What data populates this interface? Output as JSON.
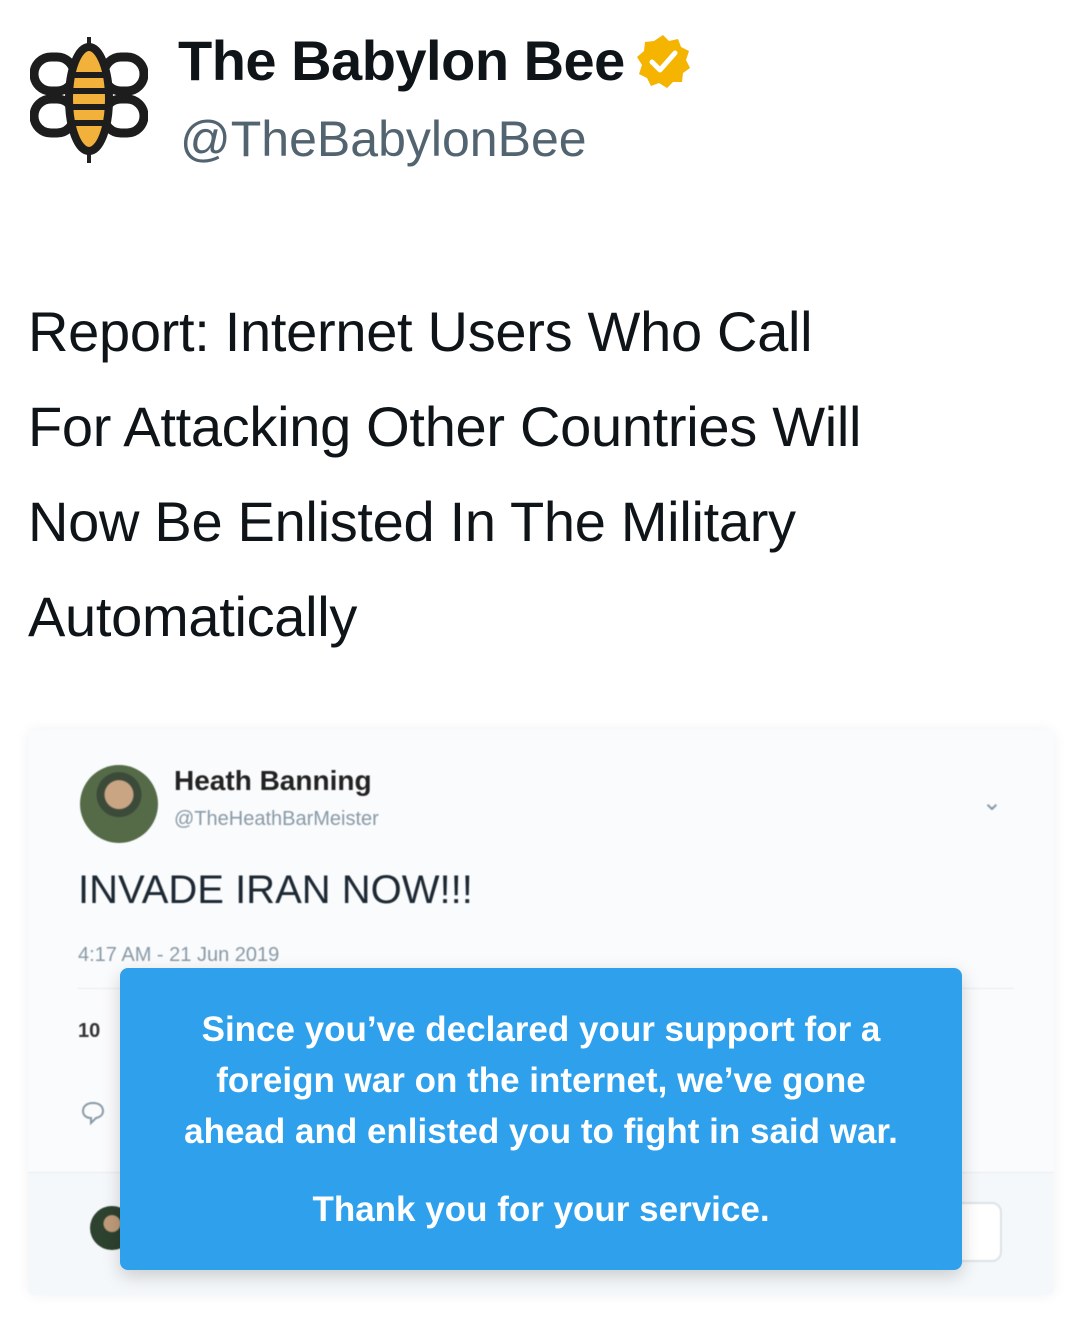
{
  "account": {
    "name": "The Babylon Bee",
    "handle": "@TheBabylonBee",
    "verified": true,
    "badge_color": "#f4b400",
    "logo_icon": "bee-logo-icon"
  },
  "tweet": {
    "text_lines": [
      "Report: Internet Users Who Call",
      "For Attacking Other Countries Will",
      "Now Be Enlisted In The Military",
      "Automatically"
    ]
  },
  "embedded": {
    "name": "Heath Banning",
    "handle": "@TheHeathBarMeister",
    "text": "INVADE IRAN NOW!!!",
    "time": "4:17 AM - 21 Jun 2019",
    "stat": "10",
    "reply_icon": "reply-icon",
    "menu_icon": "chevron-down-icon"
  },
  "popup": {
    "color": "#2ea0ec",
    "lines": [
      "Since you’ve declared your support for a",
      "foreign war on the internet, we’ve gone",
      "ahead and enlisted you to fight in said war."
    ],
    "thanks": "Thank you for your service."
  }
}
